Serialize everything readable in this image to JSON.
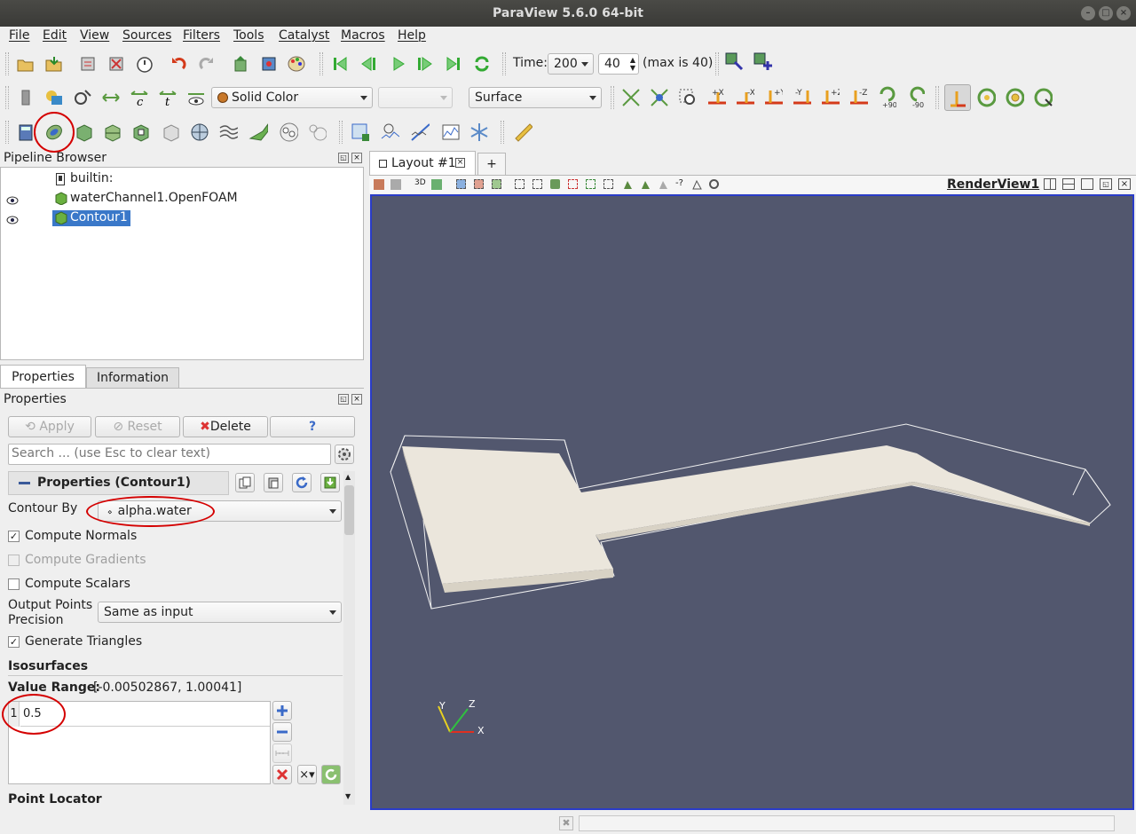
{
  "window": {
    "title": "ParaView 5.6.0 64-bit"
  },
  "menubar": [
    "File",
    "Edit",
    "View",
    "Sources",
    "Filters",
    "Tools",
    "Catalyst",
    "Macros",
    "Help"
  ],
  "time_toolbar": {
    "time_label": "Time:",
    "time_value": "200",
    "index_value": "40",
    "max_text": "(max is 40)"
  },
  "display_toolbar": {
    "color_by": "Solid Color",
    "component": "",
    "representation": "Surface"
  },
  "camera_labels": [
    "+X",
    "-X",
    "+Y",
    "-Y",
    "+Z",
    "-Z",
    "+90",
    "-90"
  ],
  "pipeline": {
    "title": "Pipeline Browser",
    "items": [
      {
        "label": "builtin:",
        "visible": false,
        "selected": false
      },
      {
        "label": "waterChannel1.OpenFOAM",
        "visible": true,
        "selected": false
      },
      {
        "label": "Contour1",
        "visible": true,
        "selected": true
      }
    ]
  },
  "tabs": {
    "properties": "Properties",
    "information": "Information"
  },
  "properties_panel": {
    "title": "Properties",
    "apply": "Apply",
    "reset": "Reset",
    "delete": "Delete",
    "help": "?",
    "search_placeholder": "Search ... (use Esc to clear text)",
    "section_title": "Properties (Contour1)",
    "contour_by_label": "Contour By",
    "contour_by_value": "alpha.water",
    "compute_normals": "Compute Normals",
    "compute_gradients": "Compute Gradients",
    "compute_scalars": "Compute Scalars",
    "output_points_label_1": "Output Points",
    "output_points_label_2": "Precision",
    "output_points_value": "Same as input",
    "generate_triangles": "Generate Triangles",
    "isosurfaces_title": "Isosurfaces",
    "value_range_label": "Value Range:",
    "value_range_value": "[-0.00502867, 1.00041]",
    "iso_row_index": "1",
    "iso_row_value": "0.5",
    "point_locator": "Point Locator"
  },
  "layout": {
    "tab_label": "Layout #1",
    "add_tab": "+",
    "render_view": "RenderView1",
    "toolbar_3d": "3D"
  },
  "axes": {
    "x": "X",
    "y": "Y",
    "z": "Z"
  },
  "colors": {
    "view_bg": "#52576e",
    "selection": "#3a78c9",
    "highlight_circle": "#d40000"
  }
}
